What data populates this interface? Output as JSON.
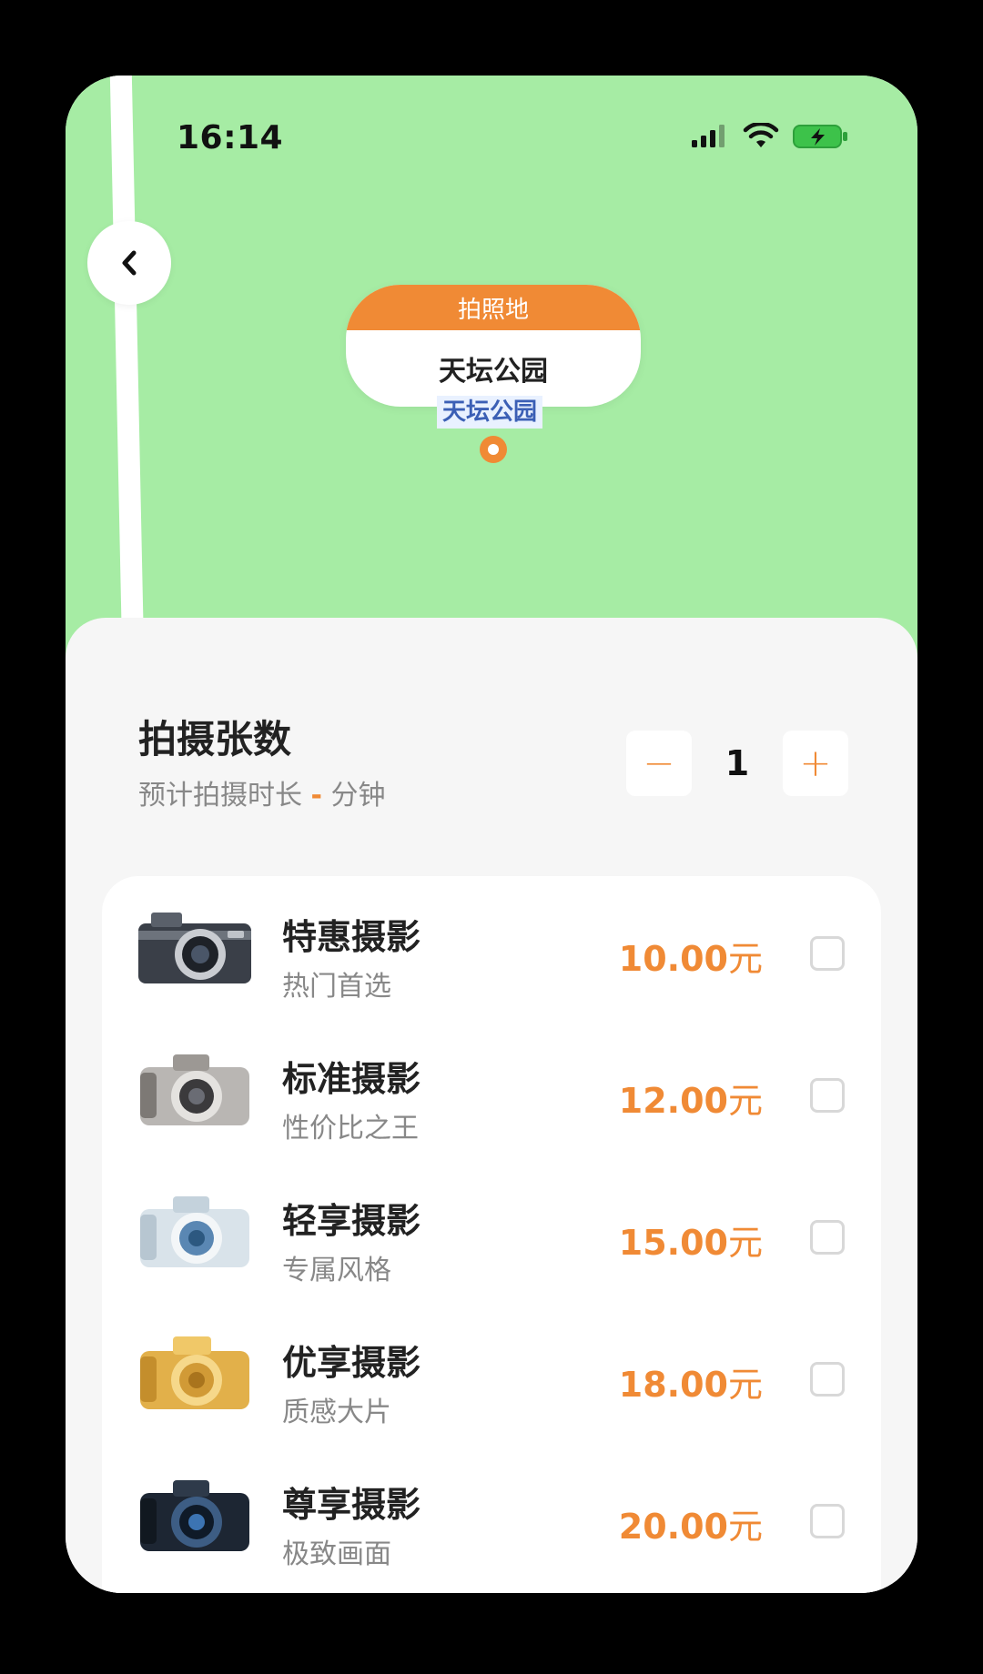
{
  "status_bar": {
    "time": "16:14"
  },
  "map": {
    "marker_header": "拍照地",
    "marker_name": "天坛公园",
    "map_label": "天坛公园"
  },
  "sheet": {
    "title": "拍摄张数",
    "subtitle_prefix": "预计拍摄时长",
    "subtitle_dash": "-",
    "subtitle_suffix": "分钟",
    "stepper": {
      "minus": "−",
      "value": "1",
      "plus": "+"
    }
  },
  "packages": [
    {
      "name": "特惠摄影",
      "desc": "热门首选",
      "price": "10.00",
      "unit": "元",
      "icon": "dark-camera-icon",
      "checked": false
    },
    {
      "name": "标准摄影",
      "desc": "性价比之王",
      "price": "12.00",
      "unit": "元",
      "icon": "silver-camera-icon",
      "checked": false
    },
    {
      "name": "轻享摄影",
      "desc": "专属风格",
      "price": "15.00",
      "unit": "元",
      "icon": "blue-camera-icon",
      "checked": false
    },
    {
      "name": "优享摄影",
      "desc": "质感大片",
      "price": "18.00",
      "unit": "元",
      "icon": "gold-camera-icon",
      "checked": false
    },
    {
      "name": "尊享摄影",
      "desc": "极致画面",
      "price": "20.00",
      "unit": "元",
      "icon": "black-camera-icon",
      "checked": false
    }
  ],
  "colors": {
    "accent": "#f08a35",
    "map_green": "#a6eca4"
  }
}
